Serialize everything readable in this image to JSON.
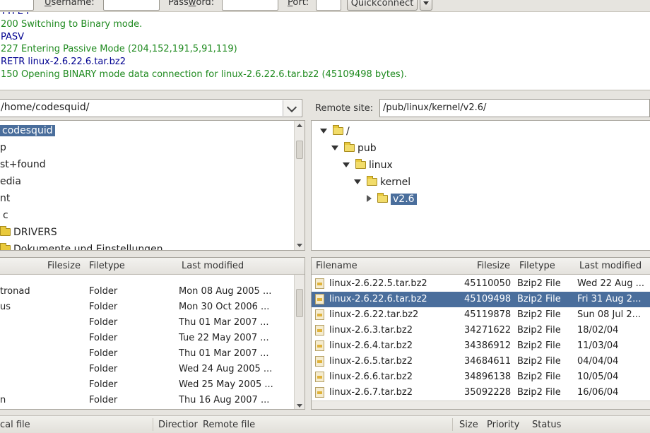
{
  "quickconnect": {
    "username_label_u": "U",
    "username_label_rest": "sername:",
    "password_label_pre": "Pass",
    "password_label_u": "w",
    "password_label_rest": "ord:",
    "port_label_u": "P",
    "port_label_rest": "ort:",
    "button_label": "Quickconnect"
  },
  "log": [
    {
      "text": "TYPE I",
      "kind": "cmd"
    },
    {
      "text": "200 Switching to Binary mode.",
      "kind": "resp"
    },
    {
      "text": "PASV",
      "kind": "cmd"
    },
    {
      "text": "227 Entering Passive Mode (204,152,191,5,91,119)",
      "kind": "resp"
    },
    {
      "text": "RETR linux-2.6.22.6.tar.bz2",
      "kind": "cmd"
    },
    {
      "text": "150 Opening BINARY mode data connection for linux-2.6.22.6.tar.bz2 (45109498 bytes).",
      "kind": "resp"
    }
  ],
  "local": {
    "path": "/home/codesquid/",
    "tree": [
      "codesquid",
      "p",
      "st+found",
      "edia",
      "nt",
      "c",
      "DRIVERS",
      "Dokumente und Einstellungen"
    ],
    "headers": {
      "filesize": "Filesize",
      "filetype": "Filetype",
      "modified": "Last modified"
    },
    "rows": [
      {
        "name": "tronad",
        "type": "Folder",
        "modified": "Mon 08 Aug 2005 ..."
      },
      {
        "name": "us",
        "type": "Folder",
        "modified": "Mon 30 Oct 2006 ..."
      },
      {
        "name": "",
        "type": "Folder",
        "modified": "Thu 01 Mar 2007 ..."
      },
      {
        "name": "",
        "type": "Folder",
        "modified": "Tue 22 May 2007 ..."
      },
      {
        "name": "",
        "type": "Folder",
        "modified": "Thu 01 Mar 2007 ..."
      },
      {
        "name": "",
        "type": "Folder",
        "modified": "Wed 24 Aug 2005 ..."
      },
      {
        "name": "",
        "type": "Folder",
        "modified": "Wed 25 May 2005 ..."
      },
      {
        "name": "n",
        "type": "Folder",
        "modified": "Thu 16 Aug 2007 ..."
      }
    ]
  },
  "remote": {
    "site_label": "Remote site:",
    "path": "/pub/linux/kernel/v2.6/",
    "tree": [
      "/",
      "pub",
      "linux",
      "kernel",
      "v2.6"
    ],
    "headers": {
      "filename": "Filename",
      "filesize": "Filesize",
      "filetype": "Filetype",
      "modified": "Last modified"
    },
    "rows": [
      {
        "name": "linux-2.6.22.5.tar.bz2",
        "size": "45110050",
        "type": "Bzip2 File",
        "modified": "Wed 22 Aug ..."
      },
      {
        "name": "linux-2.6.22.6.tar.bz2",
        "size": "45109498",
        "type": "Bzip2 File",
        "modified": "Fri 31 Aug 2..."
      },
      {
        "name": "linux-2.6.22.tar.bz2",
        "size": "45119878",
        "type": "Bzip2 File",
        "modified": "Sun 08 Jul 2..."
      },
      {
        "name": "linux-2.6.3.tar.bz2",
        "size": "34271622",
        "type": "Bzip2 File",
        "modified": "18/02/04"
      },
      {
        "name": "linux-2.6.4.tar.bz2",
        "size": "34386912",
        "type": "Bzip2 File",
        "modified": "11/03/04"
      },
      {
        "name": "linux-2.6.5.tar.bz2",
        "size": "34684611",
        "type": "Bzip2 File",
        "modified": "04/04/04"
      },
      {
        "name": "linux-2.6.6.tar.bz2",
        "size": "34896138",
        "type": "Bzip2 File",
        "modified": "10/05/04"
      },
      {
        "name": "linux-2.6.7.tar.bz2",
        "size": "35092228",
        "type": "Bzip2 File",
        "modified": "16/06/04"
      }
    ]
  },
  "queue": {
    "local_file": "cal file",
    "direction": "Directior",
    "remote_file": "Remote file",
    "size": "Size",
    "priority": "Priority",
    "status": "Status"
  }
}
